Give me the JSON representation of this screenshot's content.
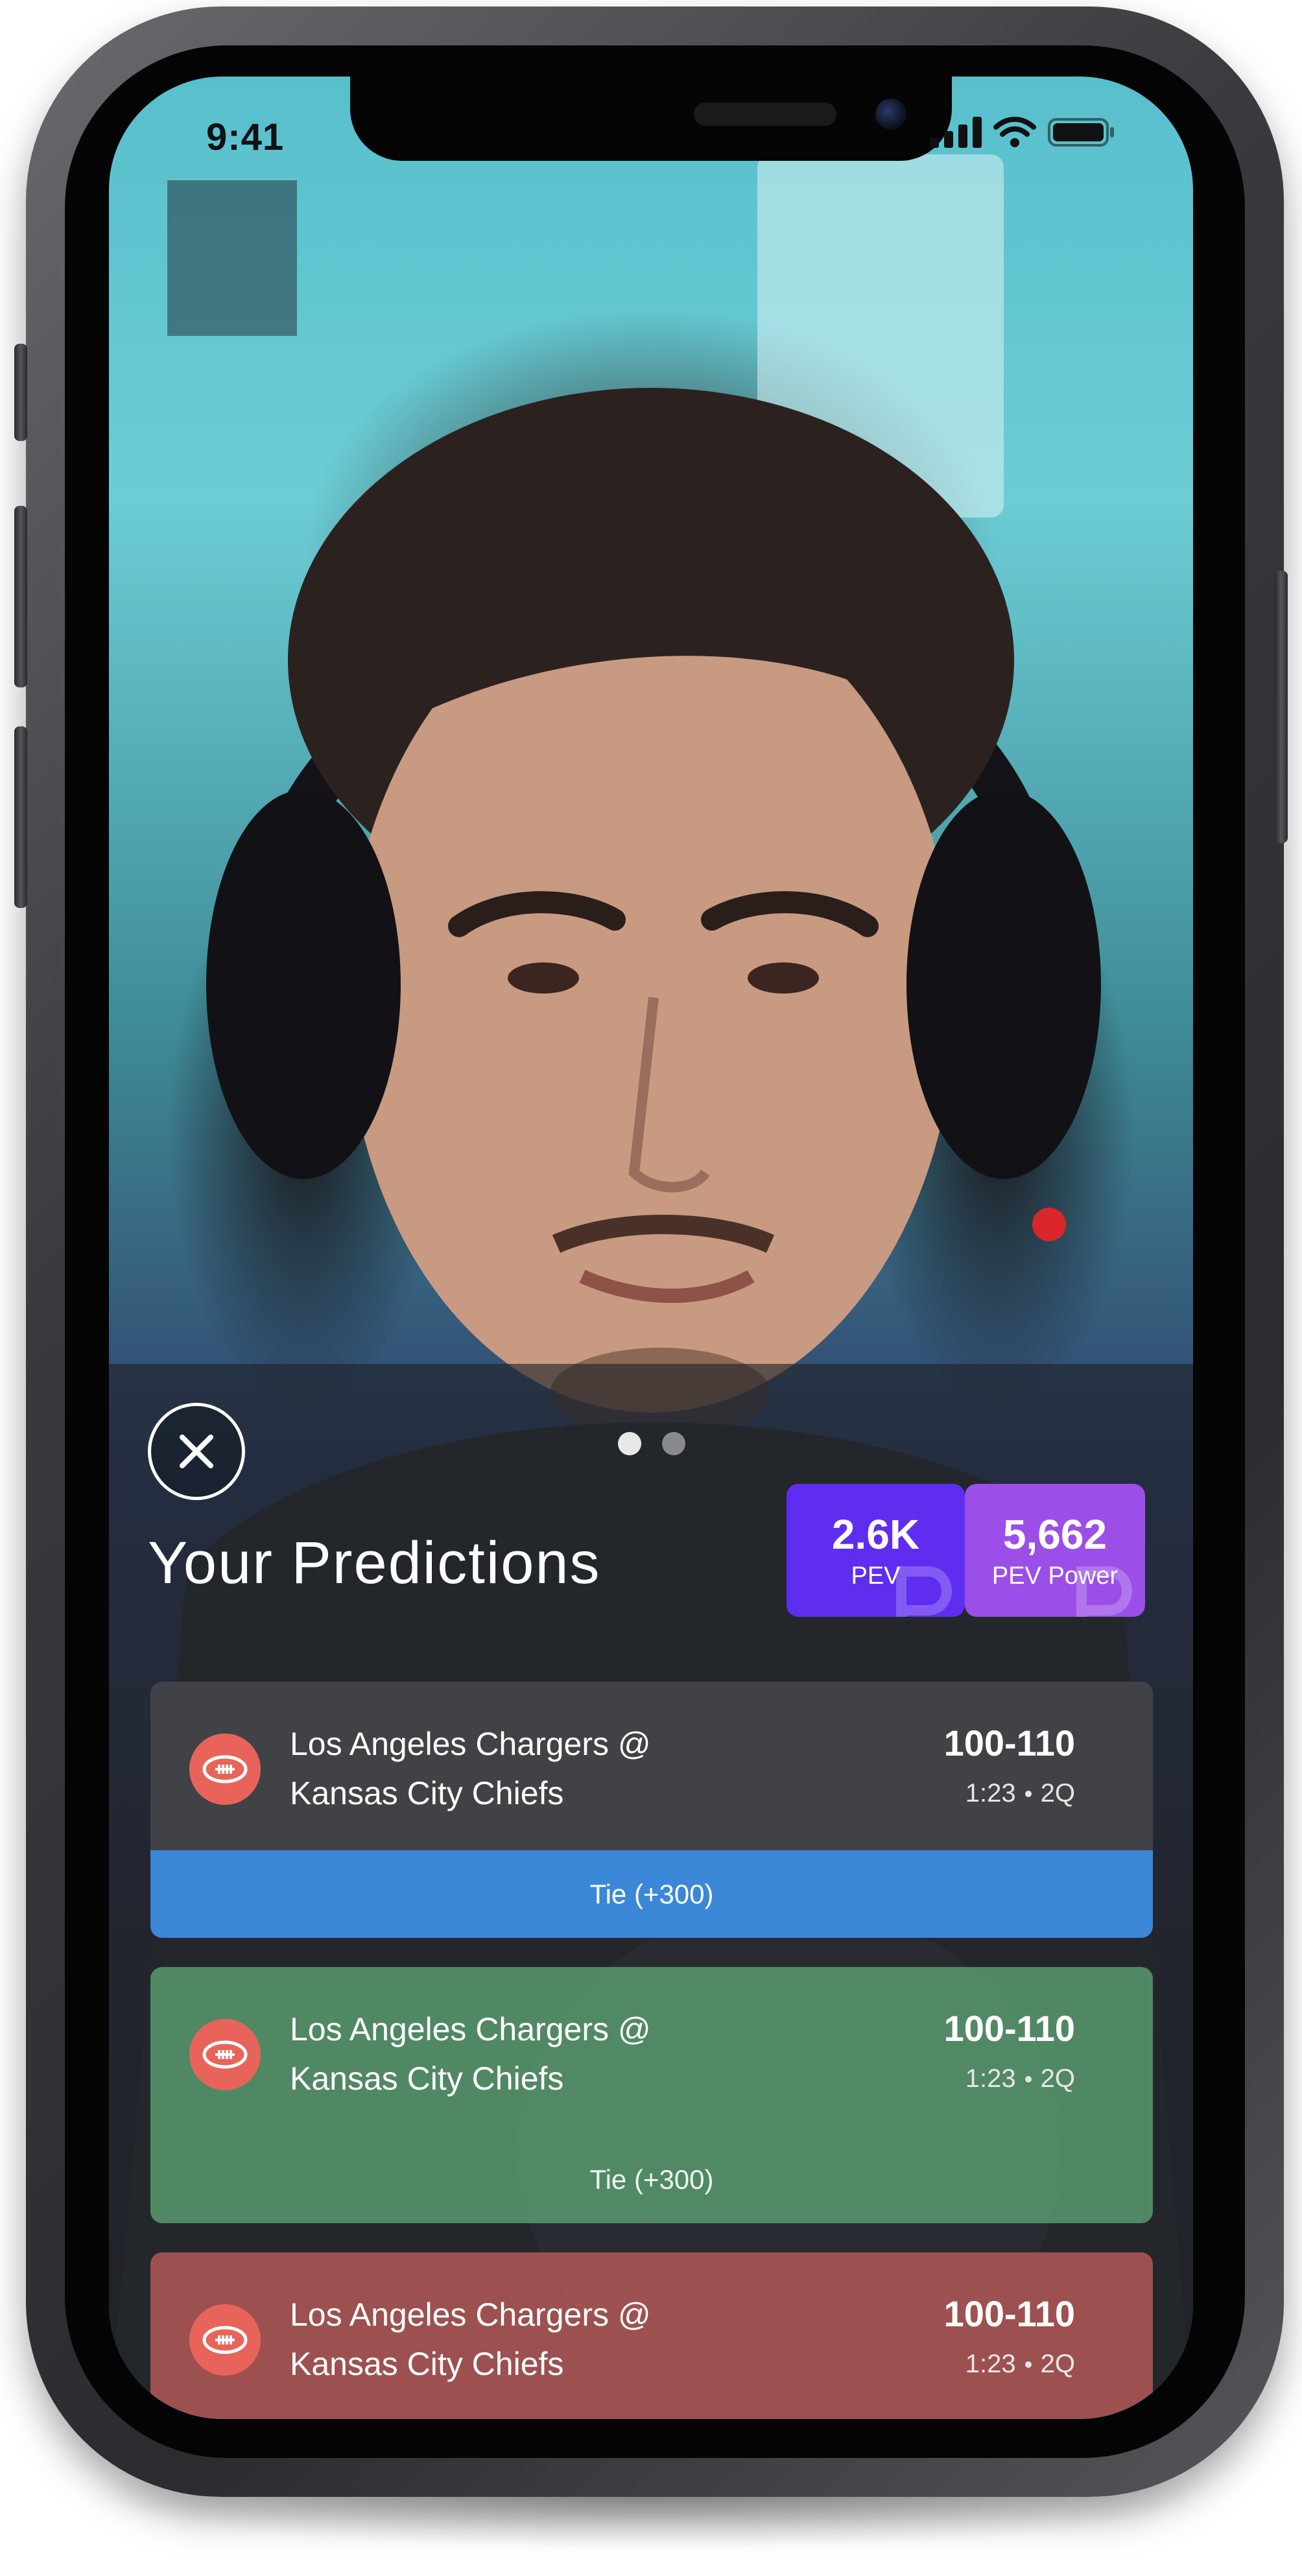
{
  "status_bar": {
    "time": "9:41"
  },
  "stream": {
    "description_icon": "video-frame"
  },
  "panel": {
    "close_icon": "close-icon",
    "pager_dots": 2,
    "pager_active_index": 0,
    "title": "Your Predictions",
    "stats": [
      {
        "value": "2.6K",
        "label": "PEV",
        "color": "#5f2df0"
      },
      {
        "value": "5,662",
        "label": "PEV Power",
        "color": "#9b4fe8"
      }
    ],
    "predictions": [
      {
        "team_line_1": "Los Angeles Chargers @",
        "team_line_2": "Kansas City Chiefs",
        "score": "100-110",
        "time": "1:23",
        "period": "2Q",
        "pick": "Tie (+300)",
        "status_color": "#3b87d8"
      },
      {
        "team_line_1": "Los Angeles Chargers @",
        "team_line_2": "Kansas City Chiefs",
        "score": "100-110",
        "time": "1:23",
        "period": "2Q",
        "pick": "Tie (+300)",
        "status_color": "#58966c"
      },
      {
        "team_line_1": "Los Angeles Chargers @",
        "team_line_2": "Kansas City Chiefs",
        "score": "100-110",
        "time": "1:23",
        "period": "2Q",
        "status_color": "#aa5654"
      }
    ]
  },
  "colors": {
    "sport_icon_bg": "#e8645a",
    "panel_overlay": "rgba(30,34,38,0.62)"
  }
}
